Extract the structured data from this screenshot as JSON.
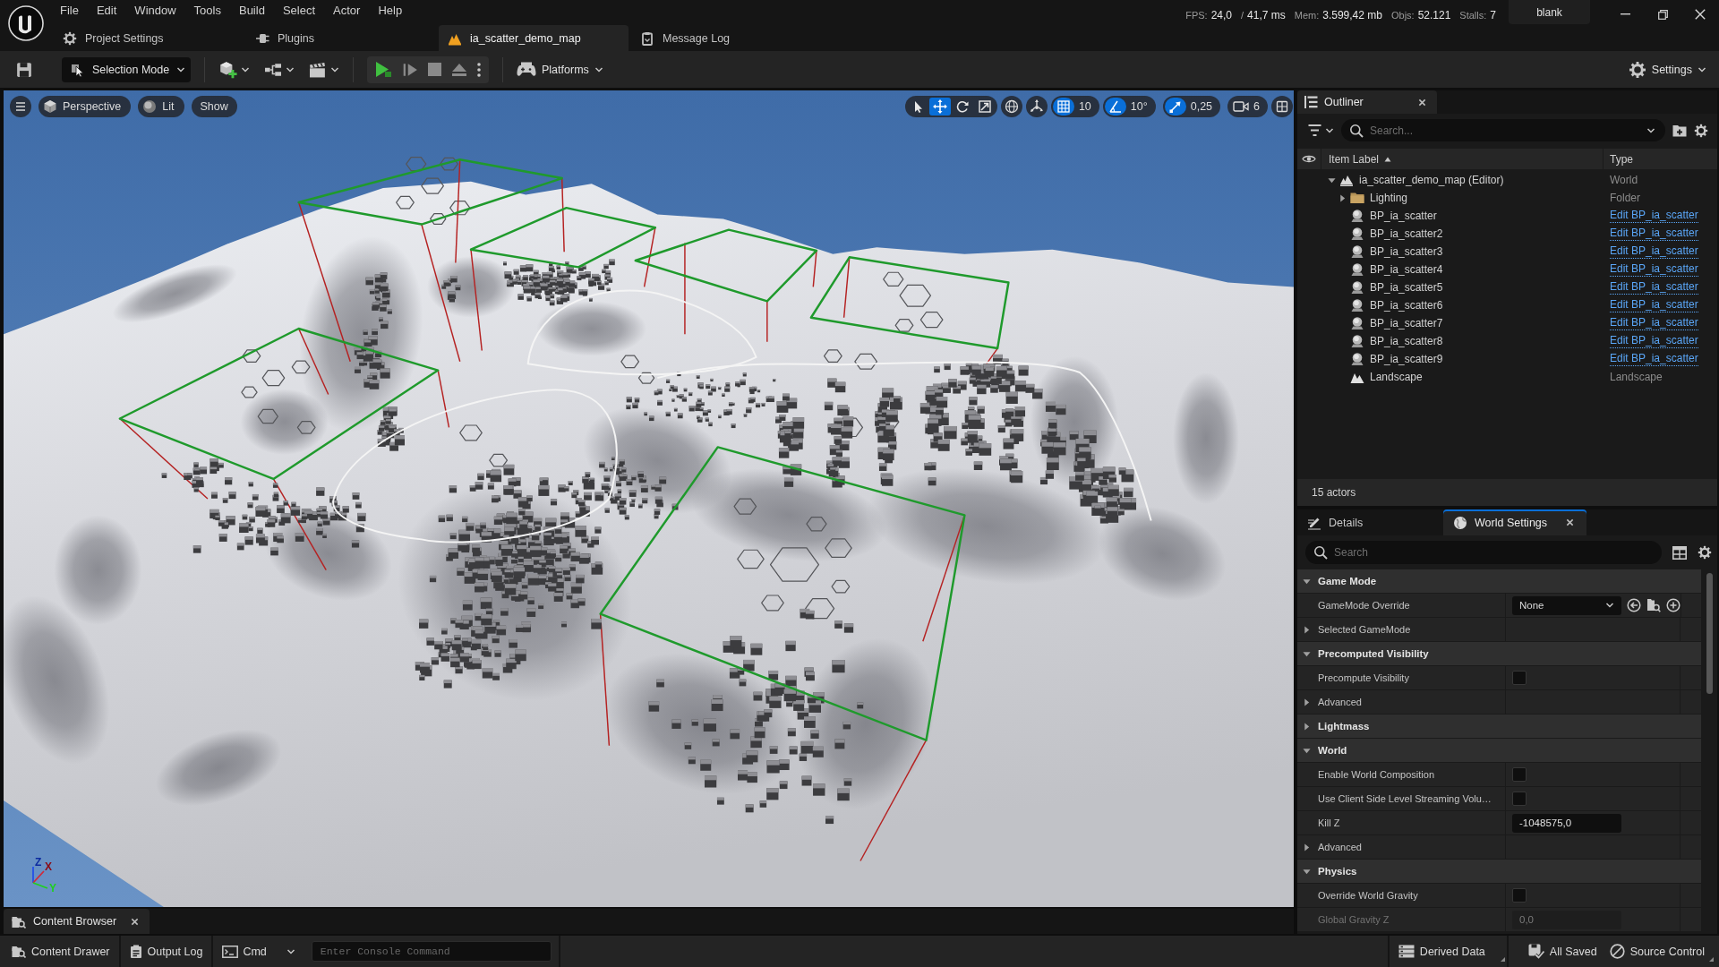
{
  "menu": [
    "File",
    "Edit",
    "Window",
    "Tools",
    "Build",
    "Select",
    "Actor",
    "Help"
  ],
  "document_tabs": [
    {
      "label": "Project Settings",
      "kind": "settings",
      "selected": false
    },
    {
      "label": "Plugins",
      "kind": "plugins",
      "selected": false
    },
    {
      "label": "ia_scatter_demo_map",
      "kind": "level",
      "selected": true
    },
    {
      "label": "Message Log",
      "kind": "log",
      "selected": false
    }
  ],
  "stats": [
    {
      "label": "FPS:",
      "value": "24,0"
    },
    {
      "label": "/",
      "value": "41,7 ms"
    },
    {
      "label": "Mem:",
      "value": "3.599,42 mb"
    },
    {
      "label": "Objs:",
      "value": "52.121"
    },
    {
      "label": "Stalls:",
      "value": "7"
    }
  ],
  "profile": "blank",
  "toolbar": {
    "mode": "Selection Mode",
    "platforms": "Platforms",
    "settings": "Settings"
  },
  "viewport": {
    "view_buttons": [
      {
        "label": "Perspective",
        "kind": "perspective"
      },
      {
        "label": "Lit",
        "kind": "lit"
      },
      {
        "label": "Show",
        "kind": "show"
      }
    ],
    "transform_tools": [
      {
        "kind": "select",
        "selected": false
      },
      {
        "kind": "move",
        "selected": true
      },
      {
        "kind": "rotate",
        "selected": false
      },
      {
        "kind": "scale",
        "selected": false
      }
    ],
    "snaps": [
      {
        "kind": "grid",
        "value": "10",
        "on": true
      },
      {
        "kind": "rotation",
        "value": "10°",
        "on": true
      },
      {
        "kind": "scale",
        "value": "0,25",
        "on": true
      }
    ],
    "camera_speed": "6",
    "axis_labels": [
      "Z",
      "X",
      "Y"
    ]
  },
  "outliner": {
    "title": "Outliner",
    "search_placeholder": "Search...",
    "columns": [
      "Item Label",
      "Type"
    ],
    "tree": [
      {
        "label": "ia_scatter_demo_map (Editor)",
        "type": "World",
        "kind": "world",
        "expanded": true,
        "children": [
          {
            "label": "Lighting",
            "type": "Folder",
            "kind": "folder",
            "expanded": false
          },
          {
            "label": "BP_ia_scatter",
            "type": "Edit BP_ia_scatter",
            "kind": "actor"
          },
          {
            "label": "BP_ia_scatter2",
            "type": "Edit BP_ia_scatter",
            "kind": "actor"
          },
          {
            "label": "BP_ia_scatter3",
            "type": "Edit BP_ia_scatter",
            "kind": "actor"
          },
          {
            "label": "BP_ia_scatter4",
            "type": "Edit BP_ia_scatter",
            "kind": "actor"
          },
          {
            "label": "BP_ia_scatter5",
            "type": "Edit BP_ia_scatter",
            "kind": "actor"
          },
          {
            "label": "BP_ia_scatter6",
            "type": "Edit BP_ia_scatter",
            "kind": "actor"
          },
          {
            "label": "BP_ia_scatter7",
            "type": "Edit BP_ia_scatter",
            "kind": "actor"
          },
          {
            "label": "BP_ia_scatter8",
            "type": "Edit BP_ia_scatter",
            "kind": "actor"
          },
          {
            "label": "BP_ia_scatter9",
            "type": "Edit BP_ia_scatter",
            "kind": "actor"
          },
          {
            "label": "Landscape",
            "type": "Landscape",
            "kind": "landscape"
          }
        ]
      }
    ],
    "footer": "15 actors"
  },
  "details": {
    "tabs": [
      {
        "label": "Details",
        "kind": "details",
        "selected": false
      },
      {
        "label": "World Settings",
        "kind": "world",
        "selected": true
      }
    ],
    "search_placeholder": "Search",
    "categories": [
      {
        "label": "Game Mode",
        "expanded": true,
        "rows": [
          {
            "kind": "dropdown",
            "label": "GameMode Override",
            "value": "None"
          },
          {
            "kind": "group",
            "label": "Selected GameMode",
            "expanded": false
          }
        ]
      },
      {
        "label": "Precomputed Visibility",
        "expanded": true,
        "rows": [
          {
            "kind": "checkbox",
            "label": "Precompute Visibility",
            "checked": false
          },
          {
            "kind": "group",
            "label": "Advanced",
            "expanded": false
          }
        ]
      },
      {
        "label": "Lightmass",
        "expanded": false
      },
      {
        "label": "World",
        "expanded": true,
        "rows": [
          {
            "kind": "checkbox",
            "label": "Enable World Composition",
            "checked": false
          },
          {
            "kind": "checkbox",
            "label": "Use Client Side Level Streaming Volu…",
            "checked": false
          },
          {
            "kind": "number",
            "label": "Kill Z",
            "value": "-1048575,0",
            "disabled": false
          },
          {
            "kind": "group",
            "label": "Advanced",
            "expanded": false
          }
        ]
      },
      {
        "label": "Physics",
        "expanded": true,
        "rows": [
          {
            "kind": "checkbox",
            "label": "Override World Gravity",
            "checked": false
          },
          {
            "kind": "number",
            "label": "Global Gravity Z",
            "value": "0,0",
            "disabled": true
          }
        ]
      }
    ]
  },
  "content_browser_tab": "Content Browser",
  "status_bar": {
    "buttons": [
      {
        "label": "Content Drawer",
        "kind": "drawer"
      },
      {
        "label": "Output Log",
        "kind": "log"
      }
    ],
    "cmd": "Cmd",
    "console_placeholder": "Enter Console Command",
    "indicators": [
      {
        "label": "Derived Data",
        "kind": "ddc"
      },
      {
        "label": "All Saved",
        "kind": "saved"
      },
      {
        "label": "Source Control",
        "kind": "source"
      }
    ]
  }
}
